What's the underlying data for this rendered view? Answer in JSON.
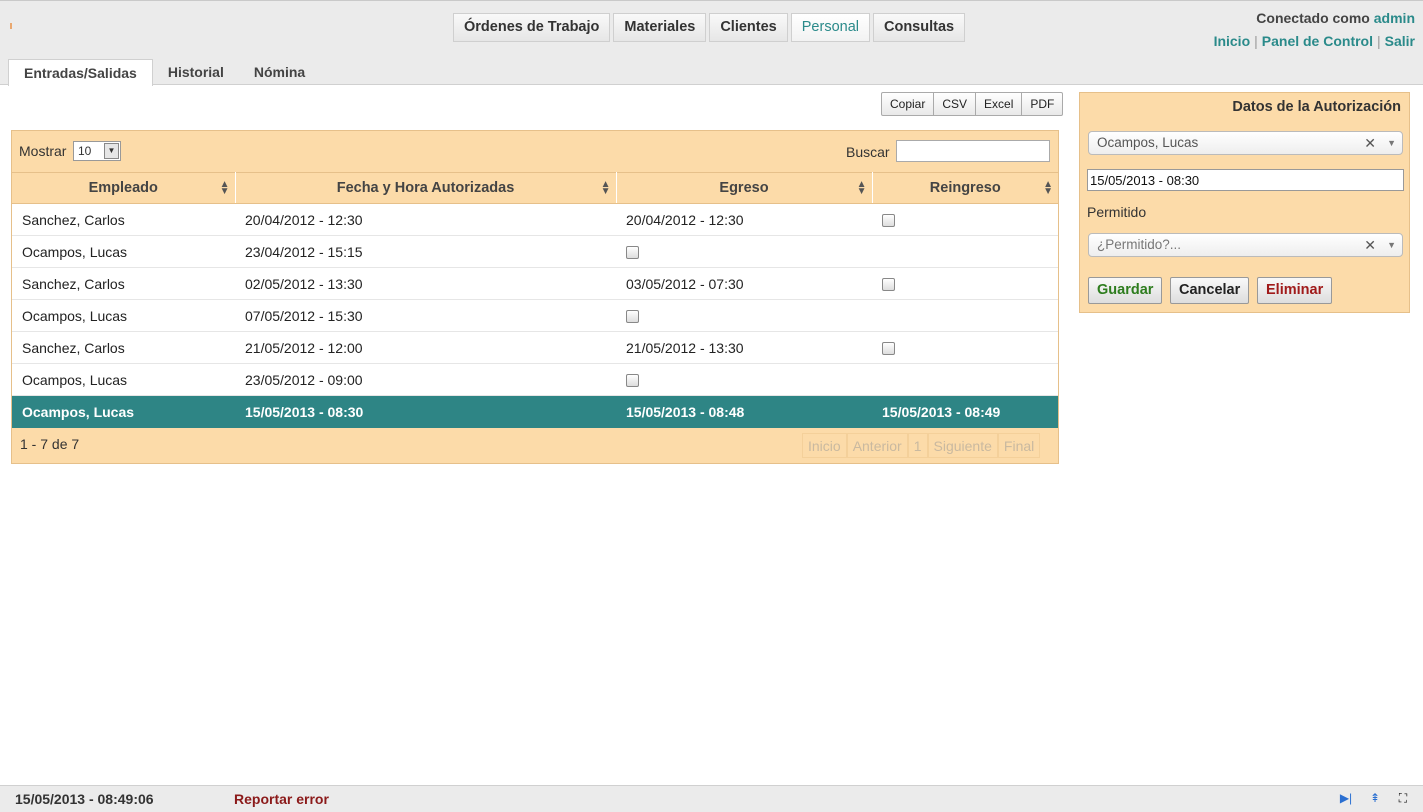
{
  "header": {
    "nav": [
      {
        "label": "Órdenes de Trabajo",
        "active": false
      },
      {
        "label": "Materiales",
        "active": false
      },
      {
        "label": "Clientes",
        "active": false
      },
      {
        "label": "Personal",
        "active": true
      },
      {
        "label": "Consultas",
        "active": false
      }
    ],
    "connected_prefix": "Conectado como",
    "username": "admin",
    "links": [
      "Inicio",
      "Panel de Control",
      "Salir"
    ],
    "link_separator": "|"
  },
  "tabs": [
    {
      "label": "Entradas/Salidas",
      "active": true
    },
    {
      "label": "Historial",
      "active": false
    },
    {
      "label": "Nómina",
      "active": false
    }
  ],
  "export_buttons": [
    "Copiar",
    "CSV",
    "Excel",
    "PDF"
  ],
  "table": {
    "show_label": "Mostrar",
    "show_value": "10",
    "search_label": "Buscar",
    "search_value": "",
    "columns": [
      "Empleado",
      "Fecha y Hora Autorizadas",
      "Egreso",
      "Reingreso"
    ],
    "rows": [
      {
        "empleado": "Sanchez, Carlos",
        "fecha": "20/04/2012 - 12:30",
        "egreso": "20/04/2012 - 12:30",
        "reingreso": ""
      },
      {
        "empleado": "Ocampos, Lucas",
        "fecha": "23/04/2012 - 15:15",
        "egreso": "",
        "reingreso": ""
      },
      {
        "empleado": "Sanchez, Carlos",
        "fecha": "02/05/2012 - 13:30",
        "egreso": "03/05/2012 - 07:30",
        "reingreso": ""
      },
      {
        "empleado": "Ocampos, Lucas",
        "fecha": "07/05/2012 - 15:30",
        "egreso": "",
        "reingreso": ""
      },
      {
        "empleado": "Sanchez, Carlos",
        "fecha": "21/05/2012 - 12:00",
        "egreso": "21/05/2012 - 13:30",
        "reingreso": ""
      },
      {
        "empleado": "Ocampos, Lucas",
        "fecha": "23/05/2012 - 09:00",
        "egreso": "",
        "reingreso": ""
      },
      {
        "empleado": "Ocampos, Lucas",
        "fecha": "15/05/2013 - 08:30",
        "egreso": "15/05/2013 - 08:48",
        "reingreso": "15/05/2013 - 08:49"
      }
    ],
    "selected_row": 6,
    "info": "1 - 7 de 7",
    "pager": [
      "Inicio",
      "Anterior",
      "1",
      "Siguiente",
      "Final"
    ]
  },
  "auth_panel": {
    "title": "Datos de la Autorización",
    "empleado_value": "Ocampos, Lucas",
    "fecha_value": "15/05/2013 - 08:30",
    "permitido_label": "Permitido",
    "permitido_placeholder": "¿Permitido?...",
    "save_label": "Guardar",
    "cancel_label": "Cancelar",
    "delete_label": "Eliminar"
  },
  "footer": {
    "clock": "15/05/2013 - 08:49:06",
    "report_label": "Reportar error"
  },
  "colors": {
    "accent": "#2a8a8a",
    "panel_bg": "#fcdba9",
    "selected_row": "#2e8585",
    "save": "#2e7d1e",
    "delete": "#a01a1a"
  },
  "icons": [
    "sort-icon",
    "clear-icon",
    "dropdown-arrow-icon",
    "play-end-icon",
    "collapse-icon",
    "fullscreen-icon"
  ]
}
